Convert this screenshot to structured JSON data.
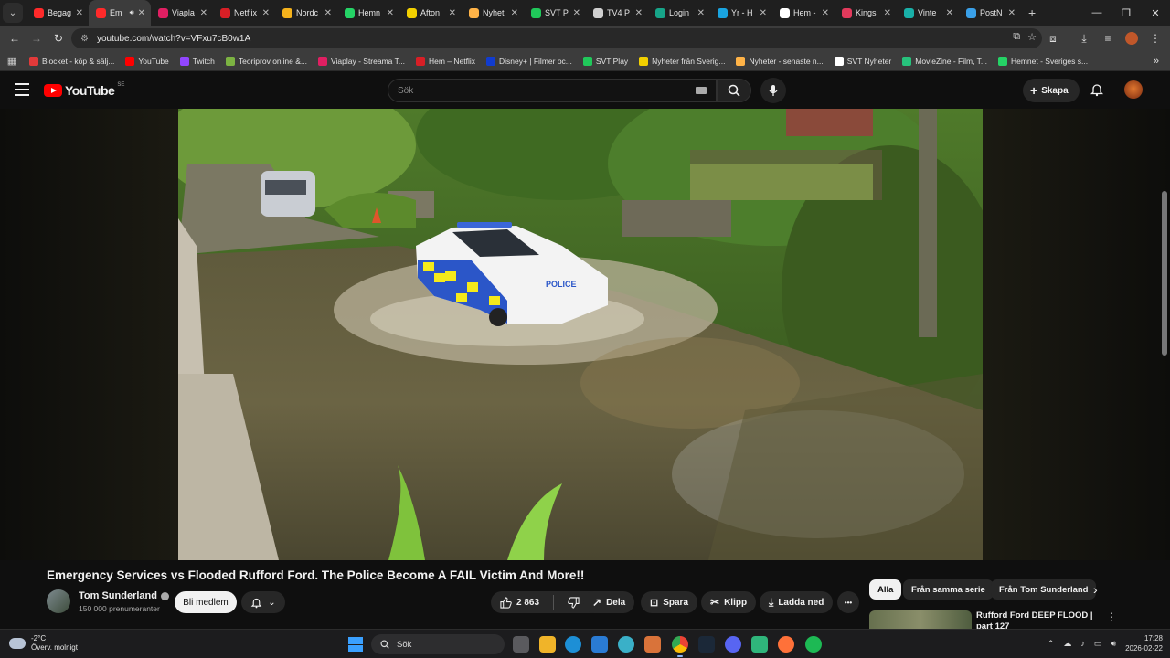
{
  "browser": {
    "tabs": [
      {
        "label": "Begag",
        "color": "#ff2a2a",
        "active": false
      },
      {
        "label": "Em",
        "color": "#ff2a2a",
        "active": true
      },
      {
        "label": "Viapla",
        "color": "#e01f62",
        "active": false
      },
      {
        "label": "Netflix",
        "color": "#d81f26",
        "active": false
      },
      {
        "label": "Nordc",
        "color": "#f5b21c",
        "active": false
      },
      {
        "label": "Hemn",
        "color": "#25d366",
        "active": false
      },
      {
        "label": "Afton",
        "color": "#f2d000",
        "active": false
      },
      {
        "label": "Nyhet",
        "color": "#ffb347",
        "active": false
      },
      {
        "label": "SVT P",
        "color": "#20c85a",
        "active": false
      },
      {
        "label": "TV4 P",
        "color": "#cfcfcf",
        "active": false
      },
      {
        "label": "Login",
        "color": "#17a589",
        "active": false
      },
      {
        "label": "Yr - H",
        "color": "#19a4e0",
        "active": false
      },
      {
        "label": "Hem -",
        "color": "#ffffff",
        "active": false
      },
      {
        "label": "Kings",
        "color": "#e23a5c",
        "active": false
      },
      {
        "label": "Vinte",
        "color": "#19b0a8",
        "active": false
      },
      {
        "label": "PostN",
        "color": "#3aa0e8",
        "active": false
      }
    ],
    "url": "youtube.com/watch?v=VFxu7cB0w1A",
    "bookmarks": [
      {
        "label": "Blocket - köp & sälj...",
        "color": "#e23a3a"
      },
      {
        "label": "YouTube",
        "color": "#ff0000"
      },
      {
        "label": "Twitch",
        "color": "#9146ff"
      },
      {
        "label": "Teoriprov online &...",
        "color": "#7cb342"
      },
      {
        "label": "Viaplay - Streama T...",
        "color": "#e01f62"
      },
      {
        "label": "Hem – Netflix",
        "color": "#d81f26"
      },
      {
        "label": "Disney+ | Filmer oc...",
        "color": "#113ccf"
      },
      {
        "label": "SVT Play",
        "color": "#20c85a"
      },
      {
        "label": "Nyheter från Sverig...",
        "color": "#f2d000"
      },
      {
        "label": "Nyheter - senaste n...",
        "color": "#ffb347"
      },
      {
        "label": "SVT Nyheter",
        "color": "#ffffff"
      },
      {
        "label": "MovieZine - Film, T...",
        "color": "#27c27c"
      },
      {
        "label": "Hemnet - Sveriges s...",
        "color": "#25d366"
      }
    ],
    "bookmarks_more": "»"
  },
  "youtube": {
    "logo_text": "YouTube",
    "logo_region": "SE",
    "search_placeholder": "Sök",
    "create_label": "Skapa"
  },
  "video": {
    "title": "Emergency Services vs Flooded Rufford Ford. The Police Become A FAIL Victim And More!!",
    "police_text": "POLICE",
    "channel_name": "Tom Sunderland",
    "subscribers": "150 000 prenumeranter",
    "join_label": "Bli medlem",
    "like_count": "2 863",
    "share_label": "Dela",
    "save_label": "Spara",
    "clip_label": "Klipp",
    "download_label": "Ladda ned",
    "more_label": "•••"
  },
  "sidebar": {
    "chips": [
      "Alla",
      "Från samma serie",
      "Från Tom Sunderland"
    ],
    "recommendation_title": "Rufford Ford DEEP FLOOD | part 127"
  },
  "taskbar": {
    "weather_temp": "-2°C",
    "weather_desc": "Överv. molnigt",
    "search_label": "Sök",
    "time": "17:28",
    "date": "2026-02-22"
  }
}
